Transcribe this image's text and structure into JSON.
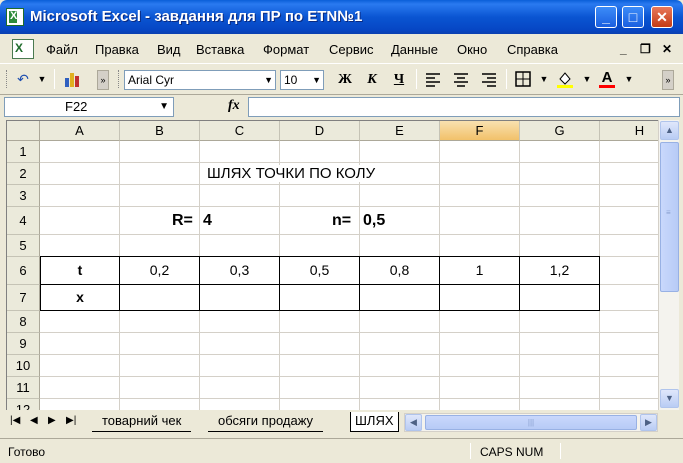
{
  "window": {
    "title": "Microsoft Excel - завдання для ПР по ETN№1",
    "minimize": "_",
    "maximize": "□",
    "close": "✕"
  },
  "menu": [
    {
      "label": "Файл"
    },
    {
      "label": "Правка"
    },
    {
      "label": "Вид"
    },
    {
      "label": "Вставка"
    },
    {
      "label": "Формат"
    },
    {
      "label": "Сервис"
    },
    {
      "label": "Данные"
    },
    {
      "label": "Окно"
    },
    {
      "label": "Справка"
    }
  ],
  "doc_controls": {
    "minimize": "_",
    "restore": "❐",
    "close": "✕"
  },
  "toolbar": {
    "font_name": "Arial Cyr",
    "font_size": "10",
    "bold": "Ж",
    "italic": "К",
    "underline": "Ч",
    "font_color_letter": "A",
    "colors": {
      "fill": "#ffff00",
      "font": "#ff0000"
    }
  },
  "formula_bar": {
    "name_box": "F22",
    "fx": "fx",
    "formula": ""
  },
  "columns": [
    "A",
    "B",
    "C",
    "D",
    "E",
    "F",
    "G",
    "H"
  ],
  "selected_column": "F",
  "rows": [
    "1",
    "2",
    "3",
    "4",
    "5",
    "6",
    "7",
    "8",
    "9",
    "10",
    "11",
    "12"
  ],
  "cells": {
    "title": "ШЛЯХ ТОЧКИ ПО КОЛУ",
    "r_label": "R=",
    "r_value": "4",
    "n_label": "n=",
    "n_value": "0,5"
  },
  "table": {
    "t_label": "t",
    "x_label": "x",
    "t_values": [
      "0,2",
      "0,3",
      "0,5",
      "0,8",
      "1",
      "1,2"
    ],
    "x_values": [
      "",
      "",
      "",
      "",
      "",
      ""
    ]
  },
  "sheet_tabs": [
    {
      "label": "товарний чек"
    },
    {
      "label": "обсяги продажу"
    },
    {
      "label": "ШЛЯХ"
    }
  ],
  "status": {
    "ready": "Готово",
    "caps": "CAPS",
    "num": "NUM"
  }
}
